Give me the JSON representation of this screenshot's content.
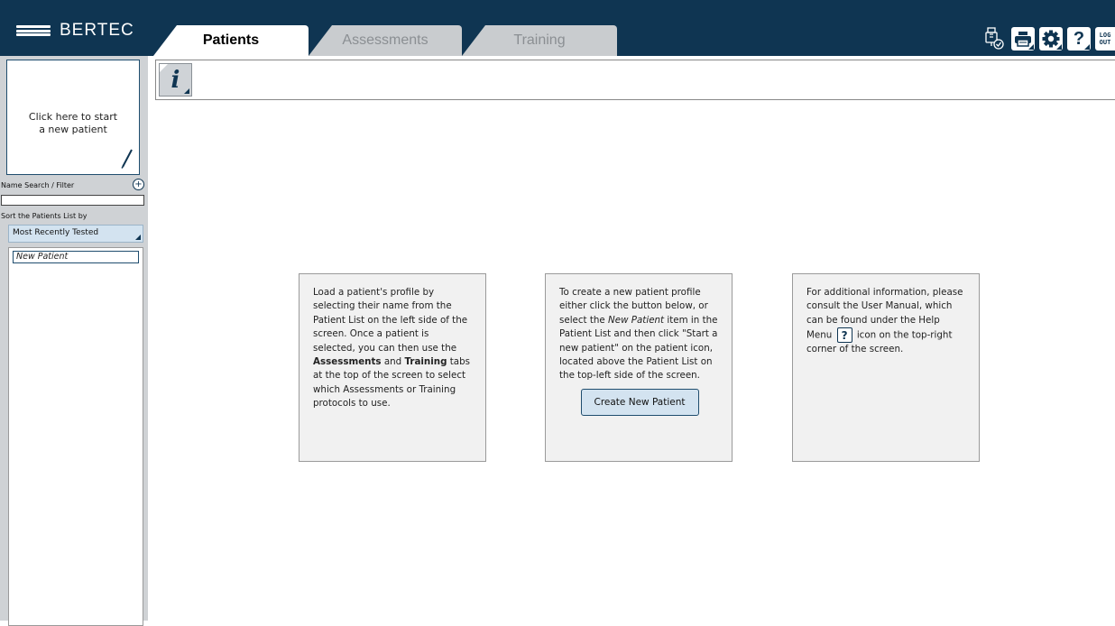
{
  "brand": {
    "logo_text": "BERTEC"
  },
  "tabs": [
    {
      "label": "Patients",
      "active": true
    },
    {
      "label": "Assessments",
      "active": false
    },
    {
      "label": "Training",
      "active": false
    }
  ],
  "toolbar": {
    "usb_icon": "usb-device-icon",
    "print_icon": "printer-icon",
    "settings_icon": "gear-icon",
    "help_label": "?",
    "logout_line1": "LOG",
    "logout_line2": "OUT"
  },
  "sidebar": {
    "new_patient_card": {
      "line1": "Click here to start",
      "line2": "a new patient"
    },
    "filter_label": "Name Search / Filter",
    "search_value": "",
    "sort_label": "Sort the Patients List by",
    "sort_selected": "Most Recently Tested",
    "patients": [
      "New Patient"
    ]
  },
  "info": {
    "icon_letter": "i"
  },
  "cards": {
    "load": {
      "p1": "Load a patient's profile by selecting their name from the Patient List on the left side of the screen. Once a patient is selected, you can then use the ",
      "bold1": "Assessments",
      "mid": " and ",
      "bold2": "Training",
      "p2": " tabs at the top of the screen to select which Assessments or Training protocols to use."
    },
    "create": {
      "p1": "To create a new patient profile either click the button below, or select the ",
      "italic": "New Patient",
      "p2": " item in the Patient List and then click \"Start a new patient\" on the patient icon, located above the Patient List on the top-left side of the screen.",
      "button_label": "Create New Patient"
    },
    "help": {
      "p1": "For additional information, please consult the User Manual, which can be found under the Help Menu ",
      "icon_label": "?",
      "p2": " icon on the top-right corner of the screen."
    }
  },
  "colors": {
    "header_bg": "#0f3552",
    "sidebar_bg": "#cfd2d5",
    "button_bg": "#d3e3f0",
    "card_bg": "#f1f1f1"
  }
}
